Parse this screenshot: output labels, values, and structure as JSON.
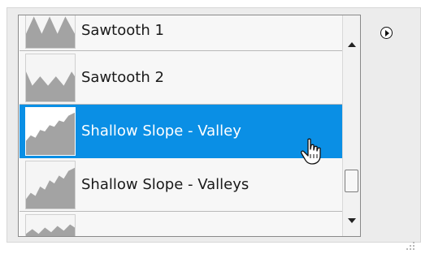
{
  "list": {
    "items": [
      {
        "label": "Sawtooth 1",
        "icon": "sawtooth-1-preview",
        "selected": false
      },
      {
        "label": "Sawtooth 2",
        "icon": "sawtooth-2-preview",
        "selected": false
      },
      {
        "label": "Shallow Slope - Valley",
        "icon": "shallow-slope-valley-preview",
        "selected": true
      },
      {
        "label": "Shallow Slope - Valleys",
        "icon": "shallow-slope-valleys-preview",
        "selected": false
      }
    ]
  },
  "colors": {
    "selection": "#0a8fe5",
    "thumbnail_fill": "#a3a3a3"
  },
  "icons": {
    "flyout": "flyout-menu-icon",
    "cursor": "hand-pointer-cursor-icon"
  }
}
